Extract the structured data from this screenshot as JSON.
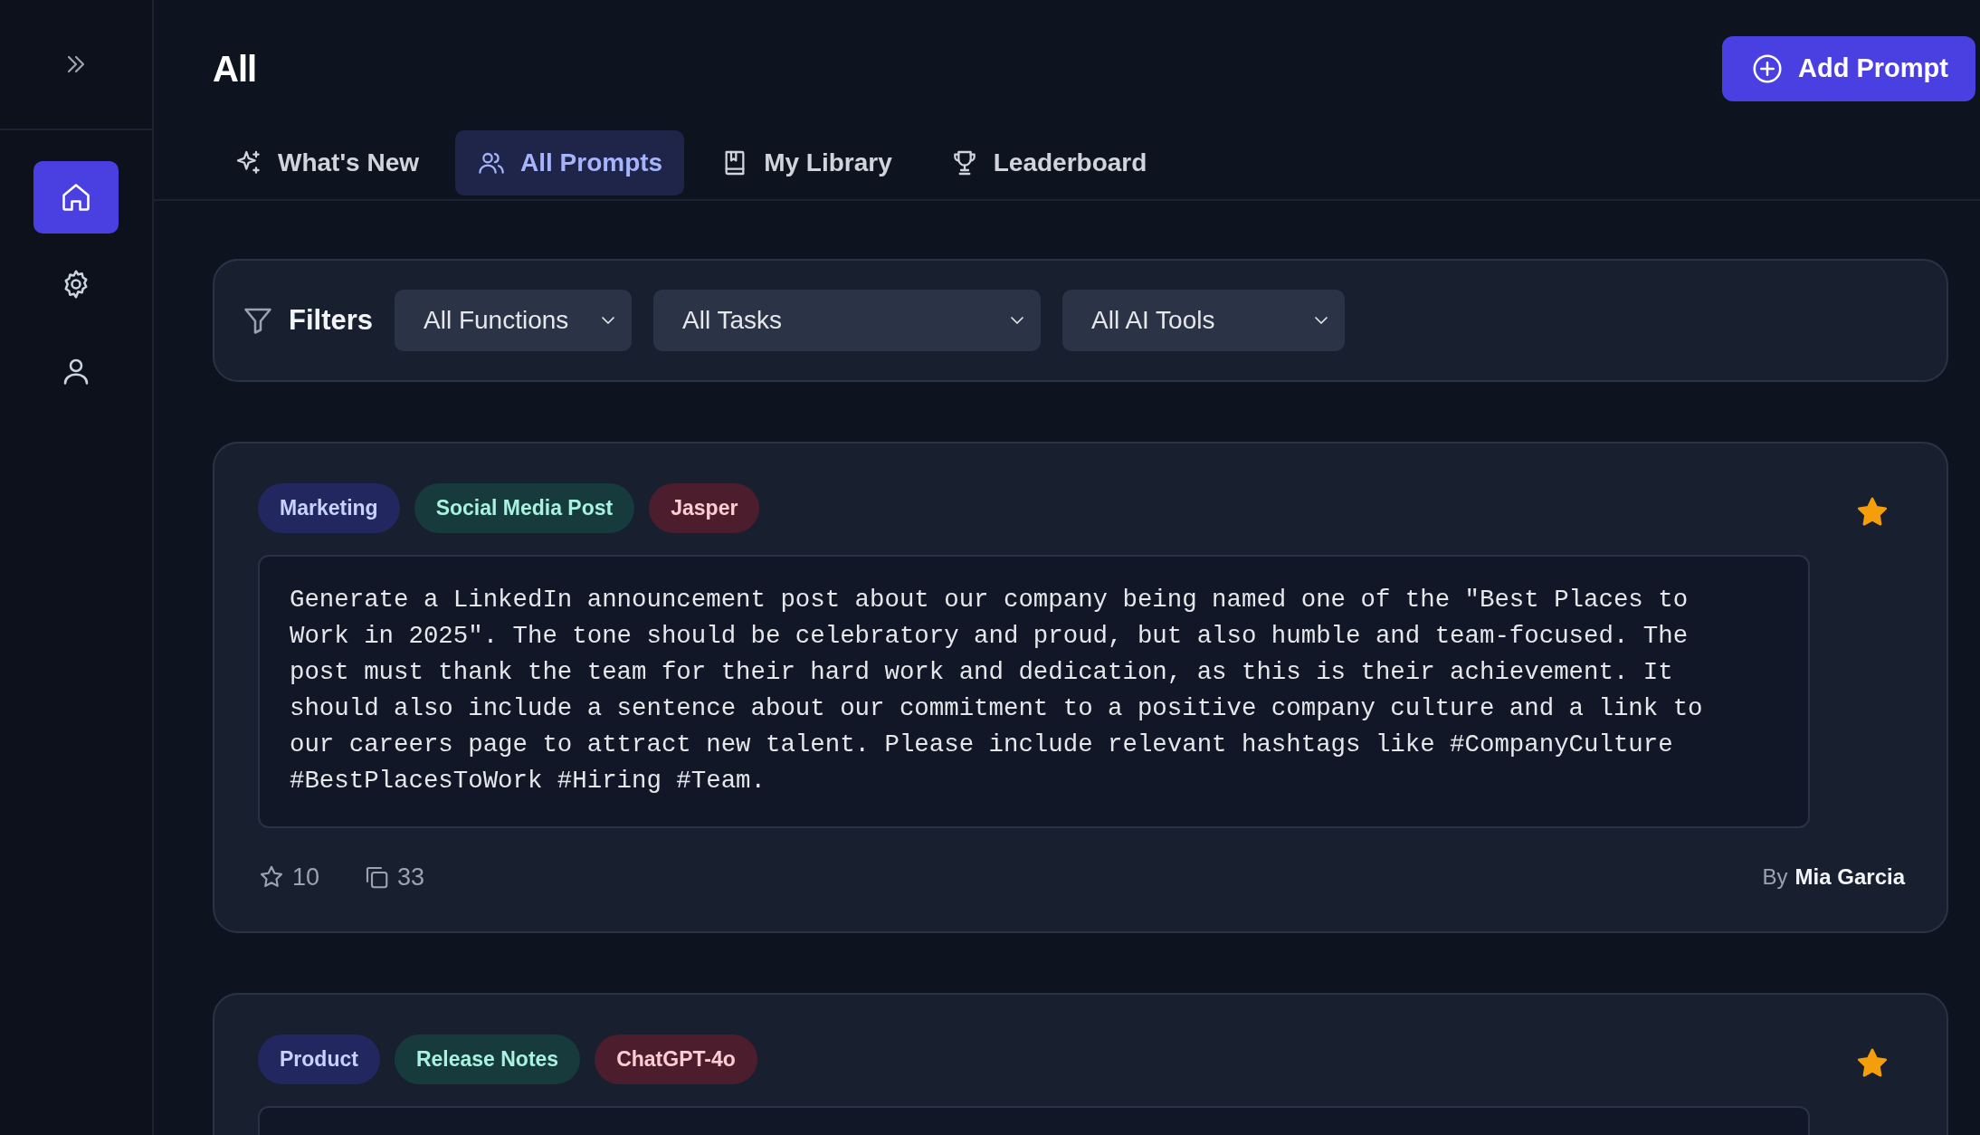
{
  "sidebar": {
    "items": [
      {
        "selected": true
      },
      {
        "selected": false
      },
      {
        "selected": false
      }
    ]
  },
  "header": {
    "title": "All",
    "add_button": "Add Prompt"
  },
  "tabs": [
    {
      "label": "What's New",
      "selected": false
    },
    {
      "label": "All Prompts",
      "selected": true
    },
    {
      "label": "My Library",
      "selected": false
    },
    {
      "label": "Leaderboard",
      "selected": false
    }
  ],
  "filters": {
    "label": "Filters",
    "dropdowns": [
      {
        "value": "All Functions"
      },
      {
        "value": "All Tasks"
      },
      {
        "value": "All AI Tools"
      }
    ]
  },
  "prompts": [
    {
      "tags": [
        {
          "kind": "function",
          "label": "Marketing"
        },
        {
          "kind": "task",
          "label": "Social Media Post"
        },
        {
          "kind": "tool",
          "label": "Jasper"
        }
      ],
      "favorited": true,
      "text": "Generate a LinkedIn announcement post about our company being named one of the \"Best Places to Work in 2025\". The tone should be celebratory and proud, but also humble and team-focused. The post must thank the team for their hard work and dedication, as this is their achievement. It should also include a sentence about our commitment to a positive company culture and a link to our careers page to attract new talent. Please include relevant hashtags like #CompanyCulture #BestPlacesToWork #Hiring #Team.",
      "stars": "10",
      "copies": "33",
      "by": "By",
      "author": "Mia Garcia"
    },
    {
      "tags": [
        {
          "kind": "function",
          "label": "Product"
        },
        {
          "kind": "task",
          "label": "Release Notes"
        },
        {
          "kind": "tool",
          "label": "ChatGPT-4o"
        }
      ],
      "favorited": true
    }
  ]
}
